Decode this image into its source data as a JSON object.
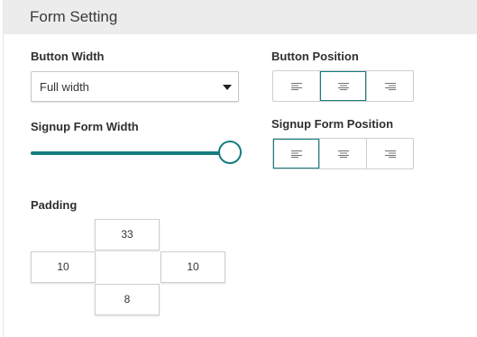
{
  "header": {
    "title": "Form Setting"
  },
  "button_width": {
    "label": "Button Width",
    "selected": "Full width"
  },
  "button_position": {
    "label": "Button Position",
    "options": [
      "align-left-icon",
      "align-center-icon",
      "align-right-icon"
    ],
    "selected": "center"
  },
  "signup_form_width": {
    "label": "Signup Form Width",
    "value_fraction": 1.0
  },
  "signup_form_position": {
    "label": "Signup Form Position",
    "options": [
      "align-left-icon",
      "align-center-icon",
      "align-right-icon"
    ],
    "selected": "left"
  },
  "padding": {
    "label": "Padding",
    "top": "33",
    "left": "10",
    "right": "10",
    "bottom": "8"
  },
  "colors": {
    "accent": "#167c80",
    "header_bg": "#ececec",
    "border": "#cfcfcf"
  }
}
